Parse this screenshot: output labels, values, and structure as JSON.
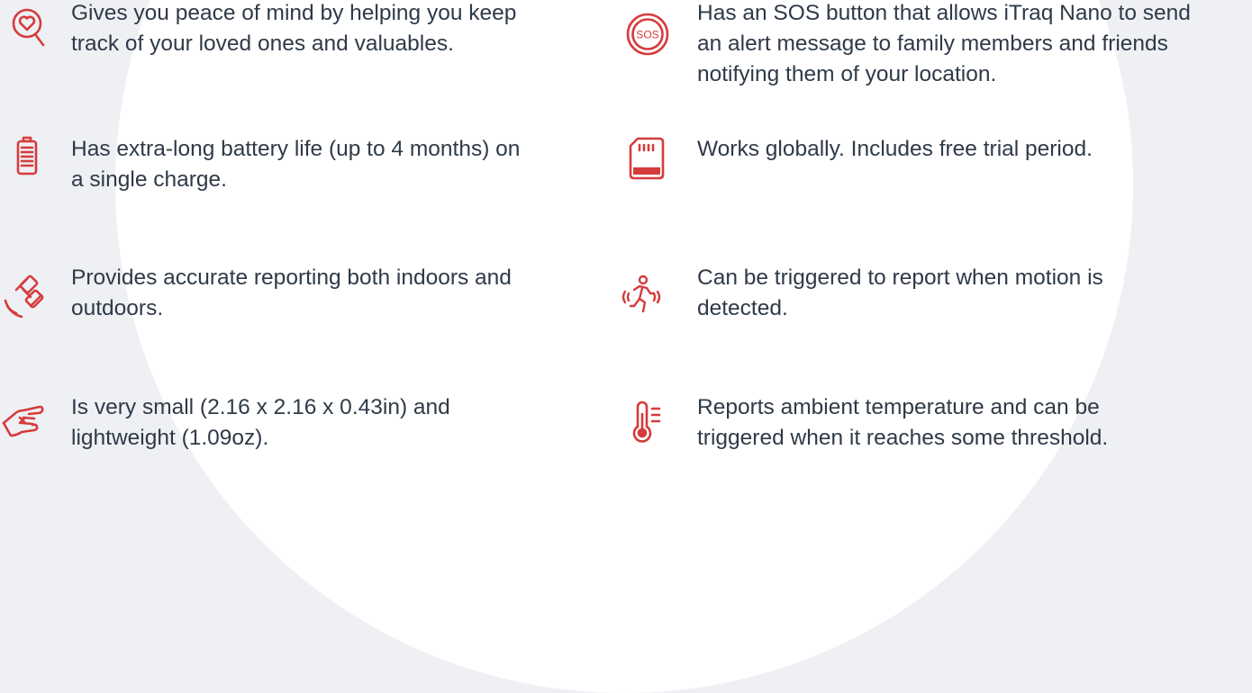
{
  "features": [
    {
      "icon": "heart-search-icon",
      "lines": [
        "Gives you peace of mind by helping you keep",
        "track of your loved ones and valuables."
      ]
    },
    {
      "icon": "sos-icon",
      "icon_text": "SOS",
      "lines": [
        "Has an SOS button that allows iTraq Nano to send",
        "an alert message to family members and friends",
        "notifying them of your location."
      ]
    },
    {
      "icon": "battery-icon",
      "lines": [
        "Has extra-long battery life (up to 4 months) on",
        "a single charge."
      ]
    },
    {
      "icon": "sim-card-icon",
      "lines": [
        "Works globally.  Includes free trial period."
      ]
    },
    {
      "icon": "satellite-icon",
      "lines": [
        "Provides accurate reporting both indoors and",
        "outdoors."
      ]
    },
    {
      "icon": "motion-icon",
      "lines": [
        "Can be triggered to report when motion is",
        "detected."
      ]
    },
    {
      "icon": "small-size-hand-icon",
      "lines": [
        "Is very small (2.16 x 2.16 x 0.43in) and",
        "lightweight (1.09oz)."
      ]
    },
    {
      "icon": "thermometer-icon",
      "lines": [
        "Reports ambient temperature and can be",
        "triggered when it reaches some threshold."
      ]
    }
  ],
  "colors": {
    "accent": "#d63b3b",
    "text": "#2f3a48",
    "background": "#eef0f4",
    "circle": "#ffffff"
  }
}
